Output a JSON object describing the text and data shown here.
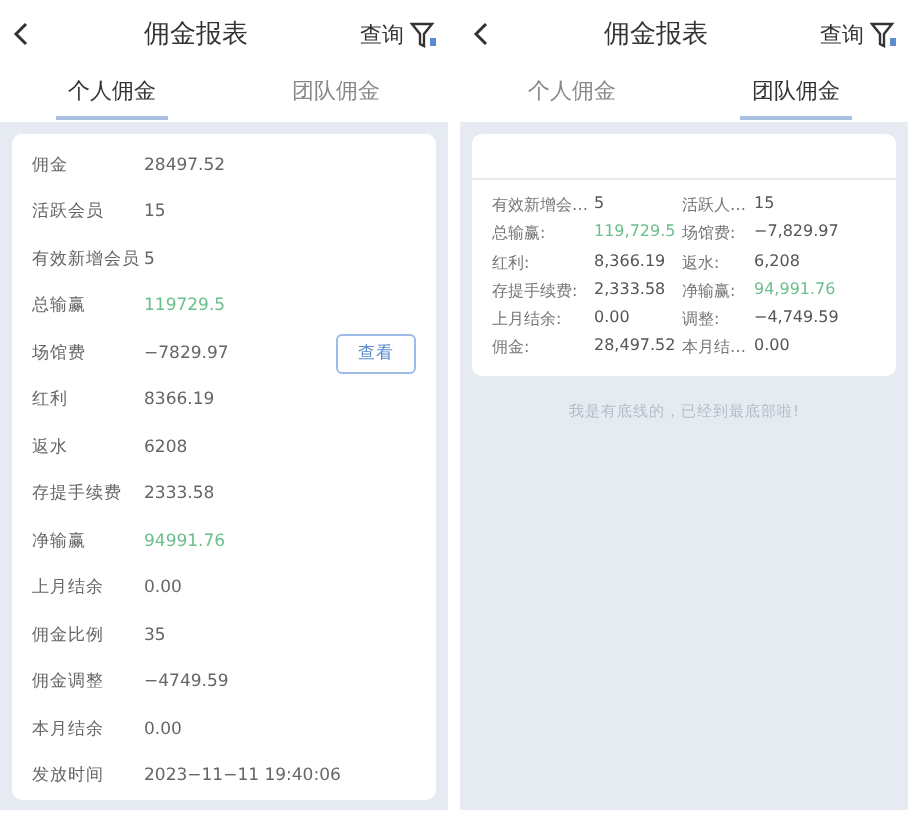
{
  "screens": [
    {
      "kind": "list",
      "title": "佣金报表",
      "query": "查询",
      "tabs": [
        {
          "label": "个人佣金",
          "selected": true
        },
        {
          "label": "团队佣金",
          "selected": false
        }
      ],
      "rows": [
        {
          "label": "佣金",
          "value": "28497.52",
          "highlight": false
        },
        {
          "label": "活跃会员",
          "value": "15",
          "highlight": false
        },
        {
          "label": "有效新增会员",
          "value": "5",
          "highlight": false
        },
        {
          "label": "总输赢",
          "value": "119729.5",
          "highlight": true
        },
        {
          "label": "场馆费",
          "value": "−7829.97",
          "highlight": false,
          "action": "查看"
        },
        {
          "label": "红利",
          "value": "8366.19",
          "highlight": false
        },
        {
          "label": "返水",
          "value": "6208",
          "highlight": false
        },
        {
          "label": "存提手续费",
          "value": "2333.58",
          "highlight": false
        },
        {
          "label": "净输赢",
          "value": "94991.76",
          "highlight": true
        },
        {
          "label": "上月结余",
          "value": "0.00",
          "highlight": false
        },
        {
          "label": "佣金比例",
          "value": "35",
          "highlight": false
        },
        {
          "label": "佣金调整",
          "value": "−4749.59",
          "highlight": false
        },
        {
          "label": "本月结余",
          "value": "0.00",
          "highlight": false
        },
        {
          "label": "发放时间",
          "value": "2023−11−11 19:40:06",
          "highlight": false
        }
      ]
    },
    {
      "kind": "grid",
      "title": "佣金报表",
      "query": "查询",
      "tabs": [
        {
          "label": "个人佣金",
          "selected": false
        },
        {
          "label": "团队佣金",
          "selected": true
        }
      ],
      "rows": [
        {
          "label": "有效新增会…",
          "value": "5",
          "highlight": false
        },
        {
          "label": "活跃人…",
          "value": "15",
          "highlight": false
        },
        {
          "label": "总输赢:",
          "value": "119,729.5",
          "highlight": true
        },
        {
          "label": "场馆费:",
          "value": "−7,829.97",
          "highlight": false
        },
        {
          "label": "红利:",
          "value": "8,366.19",
          "highlight": false
        },
        {
          "label": "返水:",
          "value": "6,208",
          "highlight": false
        },
        {
          "label": "存提手续费:",
          "value": "2,333.58",
          "highlight": false
        },
        {
          "label": "净输赢:",
          "value": "94,991.76",
          "highlight": true
        },
        {
          "label": "上月结余:",
          "value": "0.00",
          "highlight": false
        },
        {
          "label": "调整:",
          "value": "−4,749.59",
          "highlight": false
        },
        {
          "label": "佣金:",
          "value": "28,497.52",
          "highlight": false
        },
        {
          "label": "本月结…",
          "value": "0.00",
          "highlight": false
        }
      ],
      "footer": "我是有底线的，已经到最底部啦!"
    }
  ]
}
